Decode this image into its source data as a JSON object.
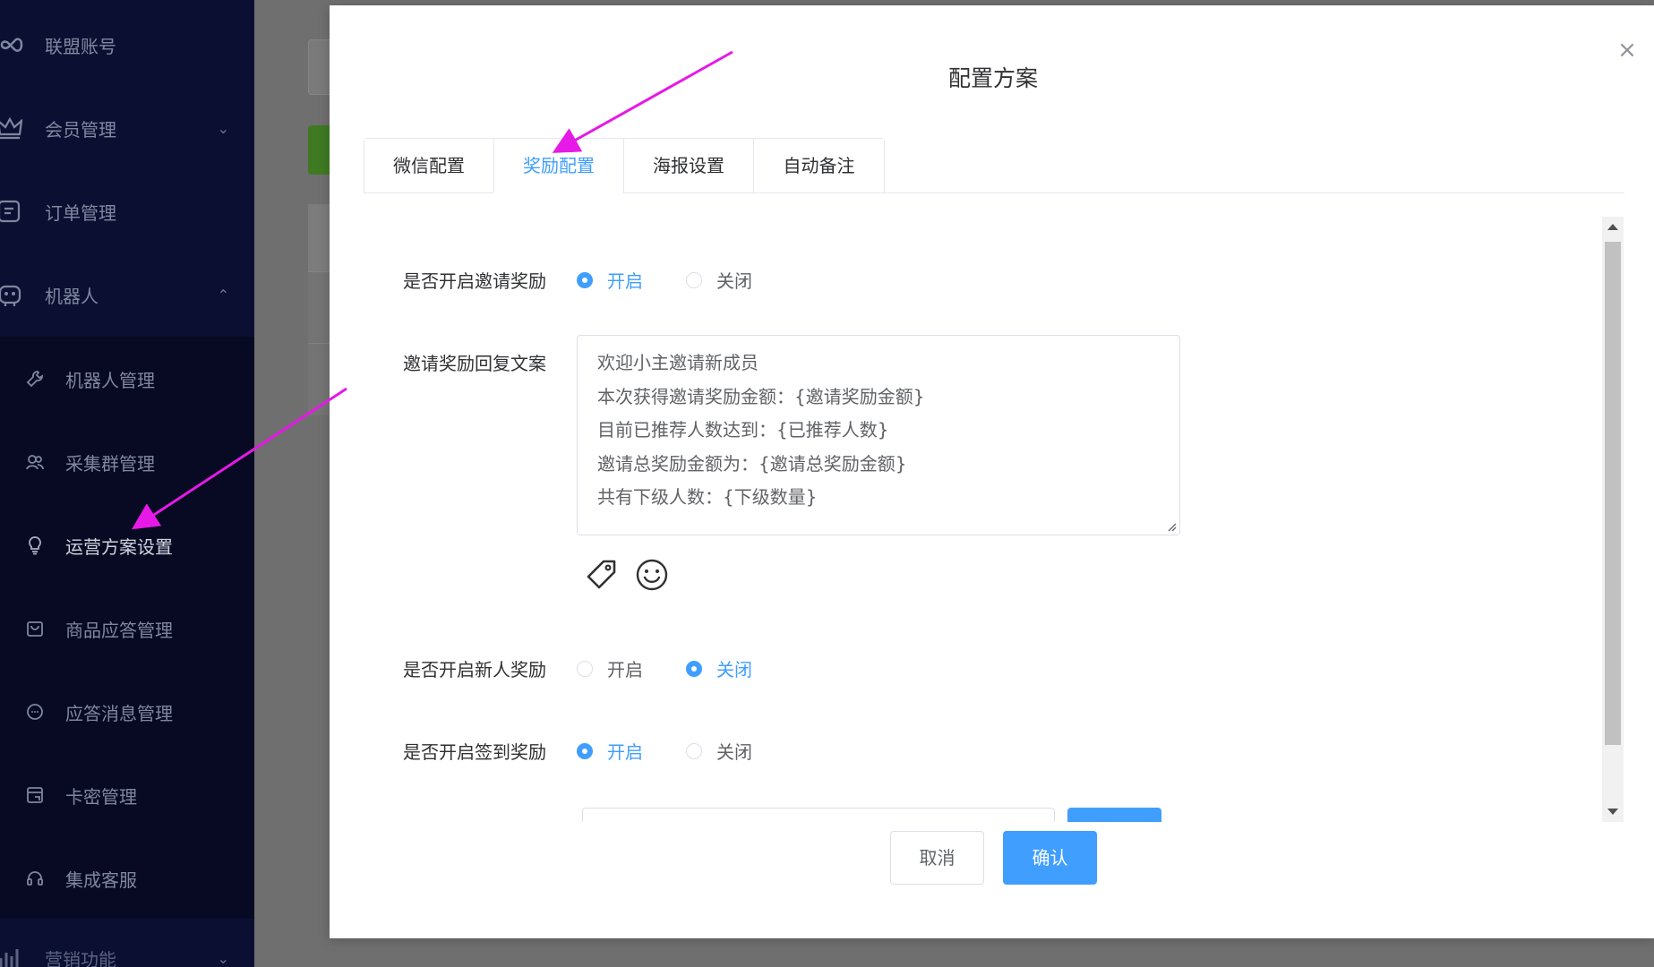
{
  "sidebar": {
    "items": [
      {
        "label": "联盟账号",
        "icon": "link-icon",
        "chevron": ""
      },
      {
        "label": "会员管理",
        "icon": "crown-icon",
        "chevron": "⌄"
      },
      {
        "label": "订单管理",
        "icon": "order-icon",
        "chevron": ""
      },
      {
        "label": "机器人",
        "icon": "robot-icon",
        "chevron": "⌃"
      }
    ],
    "subitems": [
      {
        "label": "机器人管理",
        "icon": "wrench-icon"
      },
      {
        "label": "采集群管理",
        "icon": "group-icon"
      },
      {
        "label": "运营方案设置",
        "icon": "bulb-icon"
      },
      {
        "label": "商品应答管理",
        "icon": "bag-icon"
      },
      {
        "label": "应答消息管理",
        "icon": "chat-icon"
      },
      {
        "label": "卡密管理",
        "icon": "card-icon"
      },
      {
        "label": "集成客服",
        "icon": "headset-icon"
      }
    ],
    "bottom_item": {
      "label": "营销功能",
      "icon": "chart-icon",
      "chevron": "⌄"
    }
  },
  "dialog": {
    "title": "配置方案",
    "close": "×",
    "tabs": [
      {
        "label": "微信配置",
        "active": false
      },
      {
        "label": "奖励配置",
        "active": true
      },
      {
        "label": "海报设置",
        "active": false
      },
      {
        "label": "自动备注",
        "active": false
      }
    ],
    "invite_reward": {
      "label": "是否开启邀请奖励",
      "on": "开启",
      "off": "关闭",
      "selected": "on"
    },
    "invite_reply": {
      "label": "邀请奖励回复文案",
      "lines": [
        "欢迎小主邀请新成员",
        "本次获得邀请奖励金额：{邀请奖励金额}",
        "目前已推荐人数达到：{已推荐人数}",
        "邀请总奖励金额为：{邀请总奖励金额}",
        "共有下级人数：{下级数量}"
      ]
    },
    "newbie_reward": {
      "label": "是否开启新人奖励",
      "on": "开启",
      "off": "关闭",
      "selected": "off"
    },
    "signin_reward": {
      "label": "是否开启签到奖励",
      "on": "开启",
      "off": "关闭",
      "selected": "on"
    },
    "cancel": "取消",
    "confirm": "确认"
  },
  "colors": {
    "primary": "#409eff",
    "sidebar_bg": "#0b1033",
    "annotation_arrow": "#e619e6"
  }
}
